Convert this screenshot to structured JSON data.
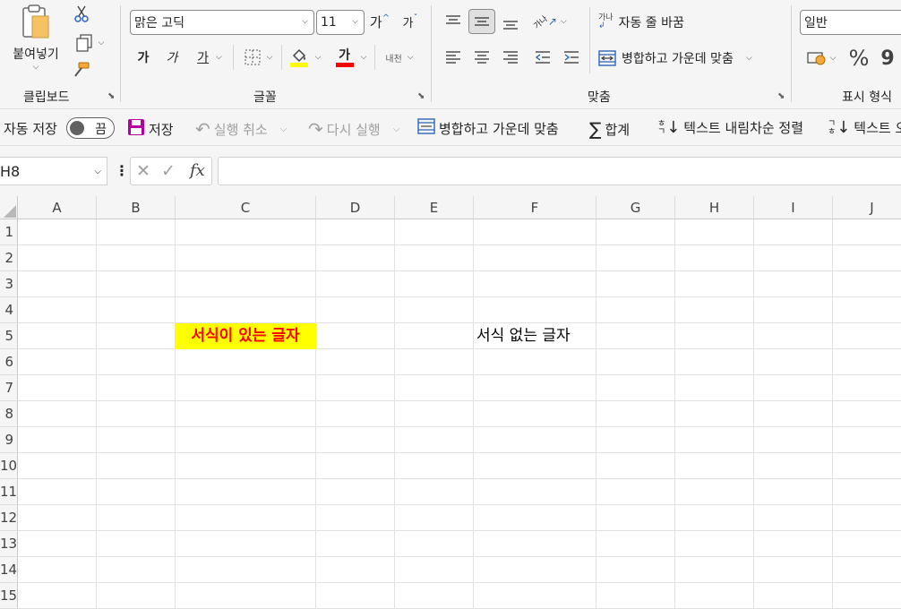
{
  "ribbon": {
    "clipboard": {
      "paste_label": "붙여넣기",
      "group_title": "클립보드"
    },
    "font": {
      "name": "맑은 고딕",
      "size": "11",
      "grow_label": "가",
      "shrink_label": "가",
      "bold_label": "가",
      "italic_label": "가",
      "underline_label": "가",
      "phonetic_label": "내천",
      "group_title": "글꼴",
      "fill_color": "#ffff00",
      "font_color": "#ff0000"
    },
    "alignment": {
      "wrap_label": "자동 줄 바꿈",
      "merge_label": "병합하고 가운데 맞춤",
      "orientation_label": "가나",
      "group_title": "맞춤"
    },
    "number": {
      "format": "일반",
      "percent": "%",
      "comma": "9",
      "group_title": "표시 형식"
    }
  },
  "qat": {
    "autosave_label": "자동 저장",
    "autosave_state": "끔",
    "save_label": "저장",
    "undo_label": "실행 취소",
    "redo_label": "다시 실행",
    "merge_label": "병합하고 가운데 맞춤",
    "sum_label": "합계",
    "sort_desc_label": "텍스트 내림차순 정렬",
    "sort_asc_label": "텍스트 오"
  },
  "formula_bar": {
    "name_box": "H8",
    "fx_label": "fx",
    "content": ""
  },
  "sheet": {
    "columns": [
      "A",
      "B",
      "C",
      "D",
      "E",
      "F",
      "G",
      "H",
      "I",
      "J"
    ],
    "rows": [
      "1",
      "2",
      "3",
      "4",
      "5",
      "6",
      "7",
      "8",
      "9",
      "10",
      "11",
      "12",
      "13",
      "14",
      "15"
    ],
    "formatted_cell": {
      "ref": "C5",
      "text": "서식이 있는 글자",
      "fill": "#ffff00",
      "color": "#ff0000",
      "bold": true
    },
    "plain_cell": {
      "ref": "F5",
      "text": "서식 없는 글자"
    }
  },
  "colors": {
    "ribbon_bg": "#f5f5f5",
    "grid_line": "#e1e1e1",
    "save_icon": "#b4009e"
  }
}
